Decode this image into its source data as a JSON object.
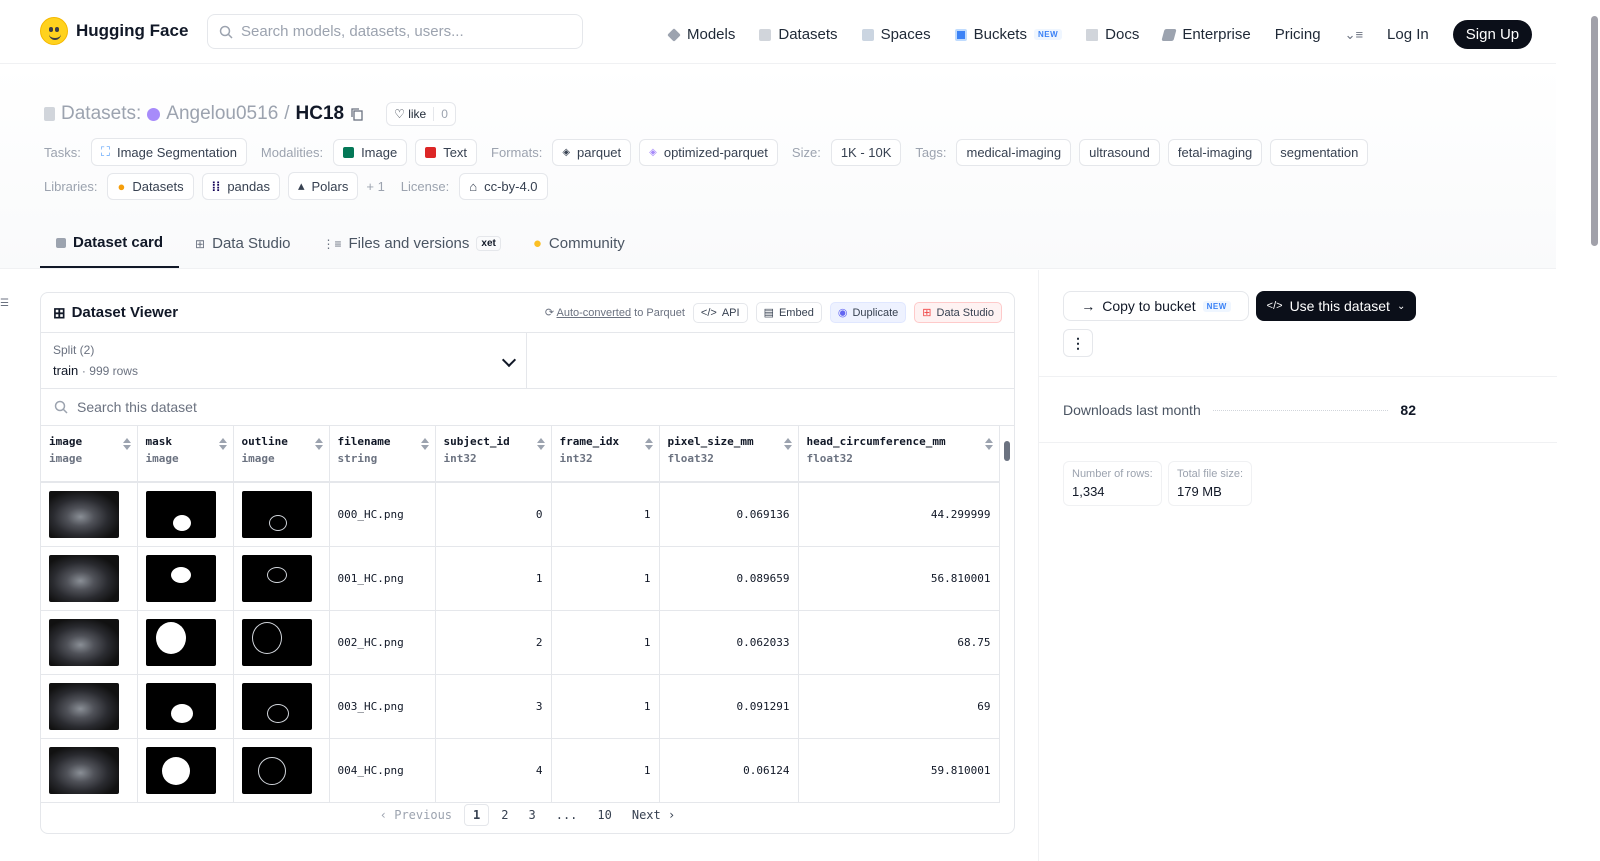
{
  "nav": {
    "logo_text": "Hugging Face",
    "search_placeholder": "Search models, datasets, users...",
    "items": [
      {
        "label": "Models",
        "icon": "models-icon"
      },
      {
        "label": "Datasets",
        "icon": "datasets-icon"
      },
      {
        "label": "Spaces",
        "icon": "spaces-icon"
      },
      {
        "label": "Buckets",
        "icon": "buckets-icon",
        "badge": "NEW"
      },
      {
        "label": "Docs",
        "icon": "docs-icon"
      },
      {
        "label": "Enterprise",
        "icon": "enterprise-icon"
      },
      {
        "label": "Pricing"
      }
    ],
    "login": "Log In",
    "signup": "Sign Up"
  },
  "header": {
    "prefix": "Datasets:",
    "owner": "Angelou0516",
    "separator": "/",
    "name": "HC18",
    "like_label": "like",
    "like_count": "0",
    "tasks_label": "Tasks:",
    "task": "Image Segmentation",
    "modalities_label": "Modalities:",
    "modalities": [
      "Image",
      "Text"
    ],
    "formats_label": "Formats:",
    "formats": [
      "parquet",
      "optimized-parquet"
    ],
    "size_label": "Size:",
    "size": "1K - 10K",
    "tags_label": "Tags:",
    "tags": [
      "medical-imaging",
      "ultrasound",
      "fetal-imaging",
      "segmentation"
    ],
    "libraries_label": "Libraries:",
    "libraries": [
      "Datasets",
      "pandas",
      "Polars"
    ],
    "libraries_more": "+ 1",
    "license_label": "License:",
    "license": "cc-by-4.0"
  },
  "tabs": [
    {
      "label": "Dataset card",
      "active": true
    },
    {
      "label": "Data Studio"
    },
    {
      "label": "Files and versions",
      "badge": "xet"
    },
    {
      "label": "Community"
    }
  ],
  "viewer": {
    "title": "Dataset Viewer",
    "auto_converted": "Auto-converted",
    "auto_converted_suffix": "to Parquet",
    "api": "API",
    "embed": "Embed",
    "duplicate": "Duplicate",
    "data_studio": "Data Studio",
    "split_label": "Split (2)",
    "split_value": "train",
    "split_rows": "999 rows",
    "search_placeholder": "Search this dataset",
    "columns": [
      {
        "name": "image",
        "type": "image"
      },
      {
        "name": "mask",
        "type": "image"
      },
      {
        "name": "outline",
        "type": "image"
      },
      {
        "name": "filename",
        "type": "string"
      },
      {
        "name": "subject_id",
        "type": "int32"
      },
      {
        "name": "frame_idx",
        "type": "int32"
      },
      {
        "name": "pixel_size_mm",
        "type": "float32"
      },
      {
        "name": "head_circumference_mm",
        "type": "float32"
      }
    ],
    "rows": [
      {
        "filename": "000_HC.png",
        "subject_id": "0",
        "frame_idx": "1",
        "pixel_size_mm": "0.069136",
        "head_circumference_mm": "44.299999"
      },
      {
        "filename": "001_HC.png",
        "subject_id": "1",
        "frame_idx": "1",
        "pixel_size_mm": "0.089659",
        "head_circumference_mm": "56.810001"
      },
      {
        "filename": "002_HC.png",
        "subject_id": "2",
        "frame_idx": "1",
        "pixel_size_mm": "0.062033",
        "head_circumference_mm": "68.75"
      },
      {
        "filename": "003_HC.png",
        "subject_id": "3",
        "frame_idx": "1",
        "pixel_size_mm": "0.091291",
        "head_circumference_mm": "69"
      },
      {
        "filename": "004_HC.png",
        "subject_id": "4",
        "frame_idx": "1",
        "pixel_size_mm": "0.06124",
        "head_circumference_mm": "59.810001"
      }
    ],
    "pager": {
      "prev": "Previous",
      "pages": [
        "1",
        "2",
        "3",
        "...",
        "10"
      ],
      "next": "Next",
      "current": "1"
    }
  },
  "sidebar": {
    "copy_to_bucket": "Copy to bucket",
    "copy_badge": "NEW",
    "use_dataset": "Use this dataset",
    "downloads_label": "Downloads last month",
    "downloads_value": "82",
    "rows_label": "Number of rows:",
    "rows_value": "1,334",
    "size_label": "Total file size:",
    "size_value": "179 MB"
  }
}
